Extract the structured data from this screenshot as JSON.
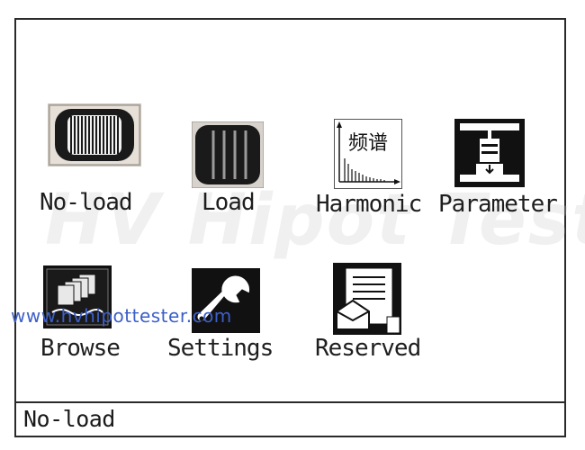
{
  "watermark": "HV Hipot Tester",
  "url_watermark": "www.hvhipottester.com",
  "menu": {
    "items": [
      {
        "label": "No-load",
        "icon": "no-load-icon"
      },
      {
        "label": "Load",
        "icon": "load-icon"
      },
      {
        "label": "Harmonic",
        "icon": "harmonic-icon",
        "icon_text": "频谱"
      },
      {
        "label": "Parameter",
        "icon": "parameter-icon"
      },
      {
        "label": "Browse",
        "icon": "browse-icon"
      },
      {
        "label": "Settings",
        "icon": "wrench-icon"
      },
      {
        "label": "Reserved",
        "icon": "reserved-icon"
      }
    ],
    "selected": "No-load"
  },
  "status": {
    "text": "No-load"
  }
}
